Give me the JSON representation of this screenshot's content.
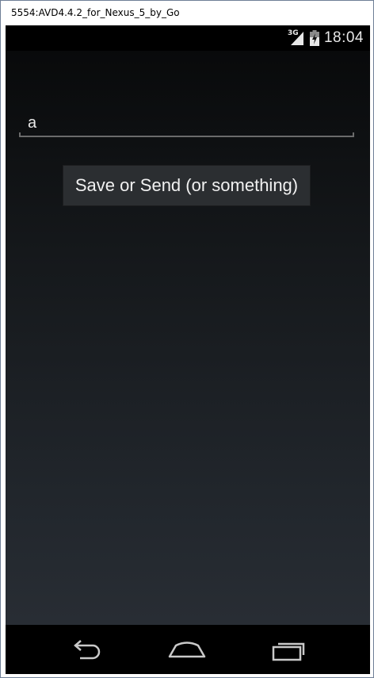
{
  "window": {
    "title": "5554:AVD4.4.2_for_Nexus_5_by_Go"
  },
  "statusbar": {
    "network_label": "3G",
    "time": "18:04",
    "icons": [
      "signal-3g-icon",
      "battery-icon"
    ]
  },
  "form": {
    "text_value": "a",
    "button_label": "Save or Send (or something)"
  },
  "navbar": {
    "icons": [
      "back-icon",
      "home-icon",
      "recents-icon"
    ]
  },
  "colors": {
    "text": "#e9e9e9",
    "button_bg": "#2b2e31",
    "underline": "#6b6b6b"
  }
}
